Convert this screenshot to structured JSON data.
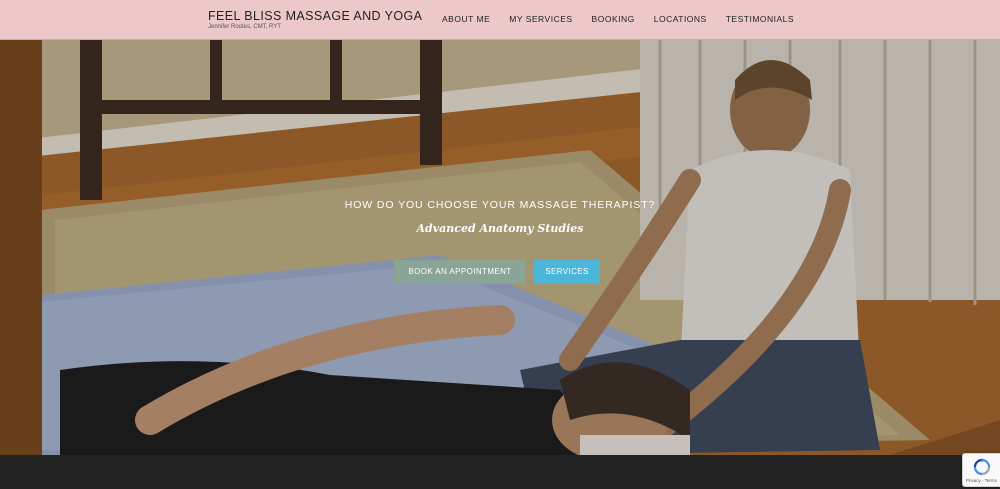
{
  "header": {
    "title": "FEEL BLISS MASSAGE AND YOGA",
    "subtitle": "Jennifer Rootes, CMT, RYT",
    "nav": [
      "ABOUT ME",
      "MY SERVICES",
      "BOOKING",
      "LOCATIONS",
      "TESTIMONIALS"
    ]
  },
  "hero": {
    "heading": "HOW DO YOU CHOOSE YOUR MASSAGE THERAPIST?",
    "subheading": "Advanced Anatomy Studies",
    "book_label": "BOOK AN APPOINTMENT",
    "services_label": "SERVICES",
    "image_description_icon": "hero-photo"
  },
  "recaptcha": {
    "text": "Privacy - Terms"
  },
  "colors": {
    "header_bg": "#ecc8cb",
    "book_button": "#8aa596",
    "services_button": "#4cb6d9",
    "footer_bg": "#232323"
  }
}
